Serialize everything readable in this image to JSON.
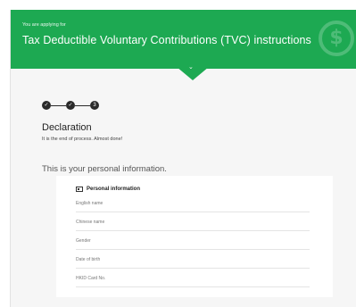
{
  "banner": {
    "kicker": "You are applying for",
    "title": "Tax Deductible Voluntary Contributions (TVC) instructions",
    "icon": "dollar-coin-icon",
    "expand_icon": "chevron-down-icon"
  },
  "progress": {
    "steps": [
      {
        "state": "done",
        "mark": "✓"
      },
      {
        "state": "done",
        "mark": "✓"
      },
      {
        "state": "current",
        "mark": "3"
      }
    ]
  },
  "step": {
    "title": "Declaration",
    "subtitle": "It is the end of process. Almost done!"
  },
  "personal": {
    "heading": "This is your personal information.",
    "card_title": "Personal information",
    "fields": [
      {
        "label": "English name"
      },
      {
        "label": "Chinese name"
      },
      {
        "label": "Gender"
      },
      {
        "label": "Date of birth"
      },
      {
        "label": "HKID Card No."
      }
    ]
  },
  "colors": {
    "brand_green": "#1da952",
    "step_dark": "#2a2a2a"
  }
}
